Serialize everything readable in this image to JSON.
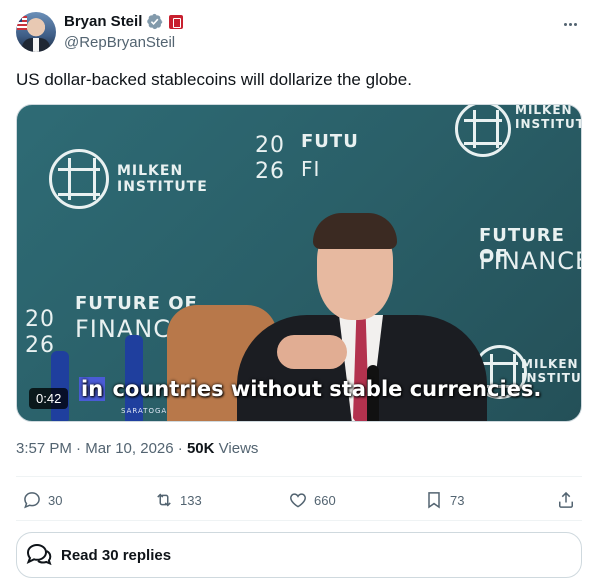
{
  "author": {
    "name": "Bryan Steil",
    "handle": "@RepBryanSteil"
  },
  "tweet": {
    "text": "US dollar-backed stablecoins will dollarize the globe."
  },
  "media": {
    "duration": "0:42",
    "caption_highlight": "in",
    "caption_rest": " countries without stable currencies.",
    "backdrop": {
      "year_top": "20",
      "year_bottom": "26",
      "future_of": "FUTURE OF",
      "finance": "FINANCE",
      "milken": "MILKEN",
      "institute": "INSTITUTE",
      "bottle_label": "SARATOGA",
      "fragment_futu": "FUTU",
      "fragment_fi": "FI"
    }
  },
  "meta": {
    "time": "3:57 PM",
    "sep1": "·",
    "date": "Mar 10, 2026",
    "sep2": "·",
    "views_count": "50K",
    "views_label": "Views"
  },
  "actions": {
    "replies": "30",
    "reposts": "133",
    "likes": "660",
    "bookmarks": "73"
  },
  "read_replies": "Read 30 replies",
  "colors": {
    "text": "#0f1419",
    "secondary": "#536471",
    "verified": "#829aab",
    "media_bg": "#2a5f68"
  }
}
